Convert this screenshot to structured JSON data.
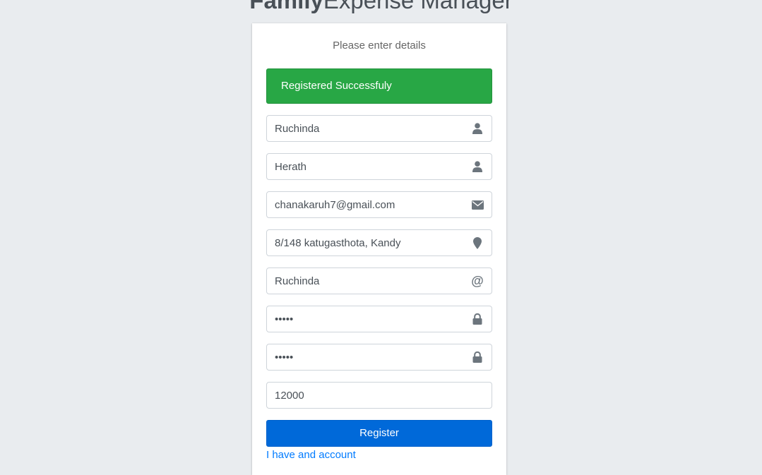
{
  "app": {
    "title_bold": "Family",
    "title_light": "Expense Manager"
  },
  "form": {
    "message": "Please enter details",
    "alert": "Registered Successfuly",
    "first_name": {
      "value": "Ruchinda",
      "icon": "user-icon"
    },
    "last_name": {
      "value": "Herath",
      "icon": "user-icon"
    },
    "email": {
      "value": "chanakaruh7@gmail.com",
      "icon": "envelope-icon"
    },
    "address": {
      "value": "8/148 katugasthota, Kandy",
      "icon": "map-marker-icon"
    },
    "username": {
      "value": "Ruchinda",
      "icon": "at-icon",
      "icon_glyph": "@"
    },
    "password": {
      "value": "•••••",
      "icon": "lock-icon"
    },
    "confirm_password": {
      "value": "•••••",
      "icon": "lock-icon"
    },
    "income": {
      "value": "12000"
    },
    "register_label": "Register",
    "account_link": "I have and account"
  },
  "colors": {
    "background": "#e9ecef",
    "success": "#28a745",
    "primary": "#0069d9",
    "link": "#007bff"
  }
}
